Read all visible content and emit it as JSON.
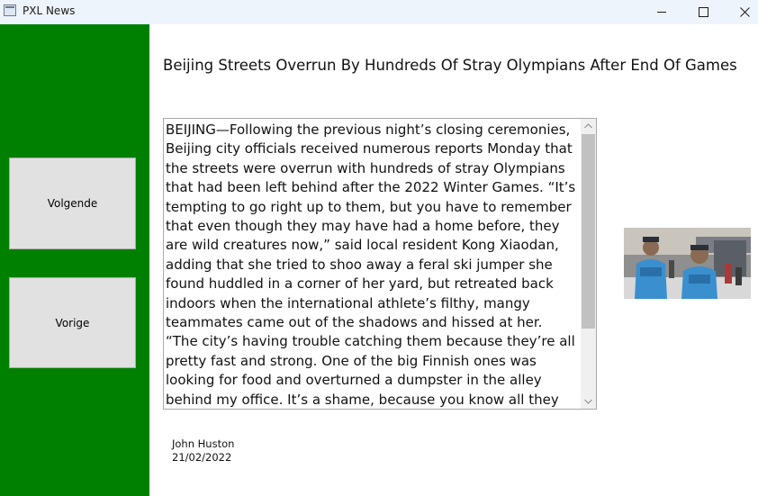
{
  "window": {
    "title": "PXL News"
  },
  "nav": {
    "next_label": "Volgende",
    "prev_label": "Vorige"
  },
  "article": {
    "headline": "Beijing Streets Overrun By Hundreds Of Stray Olympians After End Of Games",
    "body": "BEIJING—Following the previous night’s closing ceremonies, Beijing city officials received numerous reports Monday that the streets were overrun with hundreds of stray Olympians that had been left behind after the 2022 Winter Games. “It’s tempting to go right up to them, but you have to remember that even though they may have had a home before, they are wild creatures now,” said local resident Kong Xiaodan, adding that she tried to shoo away a feral ski jumper she found huddled in a corner of her yard, but retreated back indoors when the international athlete’s filthy, mangy teammates came out of the shadows and hissed at her. “The city’s having trouble catching them because they’re all pretty fast and strong. One of the big Finnish ones was looking for food and overturned a dumpster in the alley behind my office. It’s a shame, because you know all they need is a bath and someone to love them. I wouldn’t mind",
    "author": "John Huston",
    "date": "21/02/2022"
  },
  "colors": {
    "sidebar": "#008000",
    "titlebar": "#eef4fb"
  },
  "icons": {
    "app": "app-window-icon",
    "minimize": "minimize-icon",
    "maximize": "maximize-icon",
    "close": "close-icon",
    "scroll_up": "chevron-up-icon",
    "scroll_down": "chevron-down-icon"
  }
}
